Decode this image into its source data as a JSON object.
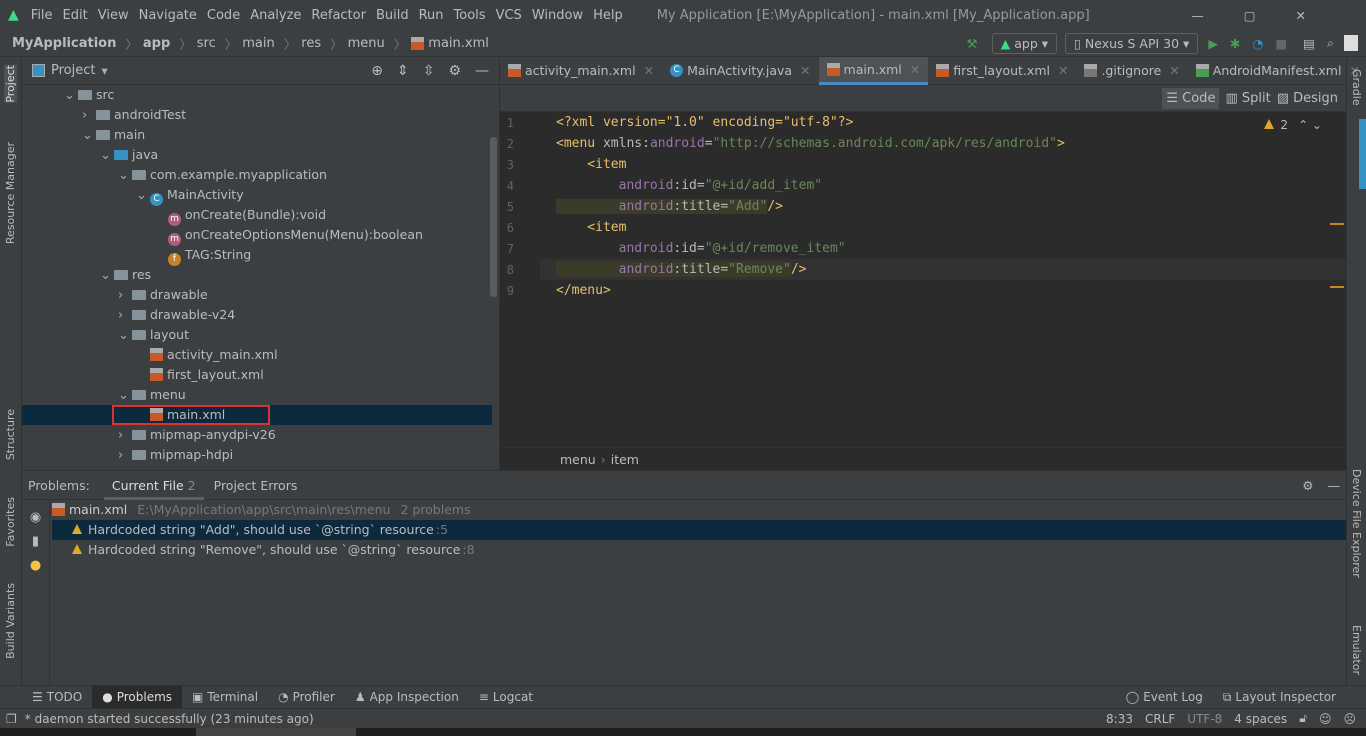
{
  "menu": {
    "items": [
      "File",
      "Edit",
      "View",
      "Navigate",
      "Code",
      "Analyze",
      "Refactor",
      "Build",
      "Run",
      "Tools",
      "VCS",
      "Window",
      "Help"
    ],
    "title": "My Application [E:\\MyApplication] - main.xml [My_Application.app]"
  },
  "nav": {
    "crumbs": [
      "MyApplication",
      "app",
      "src",
      "main",
      "res",
      "menu",
      "main.xml"
    ],
    "run_config": "app",
    "device": "Nexus S API 30"
  },
  "left_strip": [
    "Project",
    "Resource Manager",
    "Structure",
    "Favorites",
    "Build Variants"
  ],
  "right_strip": [
    "Gradle",
    "Device File Explorer",
    "Emulator"
  ],
  "project": {
    "title": "Project",
    "tree": [
      {
        "label": "src",
        "depth": 0,
        "kind": "folder",
        "open": true
      },
      {
        "label": "androidTest",
        "depth": 1,
        "kind": "folder",
        "open": false
      },
      {
        "label": "main",
        "depth": 1,
        "kind": "folder",
        "open": true
      },
      {
        "label": "java",
        "depth": 2,
        "kind": "folder",
        "open": true
      },
      {
        "label": "com.example.myapplication",
        "depth": 3,
        "kind": "package",
        "open": true
      },
      {
        "label": "MainActivity",
        "depth": 4,
        "kind": "class",
        "open": true
      },
      {
        "label": "onCreate(Bundle):void",
        "depth": 5,
        "kind": "method"
      },
      {
        "label": "onCreateOptionsMenu(Menu):boolean",
        "depth": 5,
        "kind": "method"
      },
      {
        "label": "TAG:String",
        "depth": 5,
        "kind": "field"
      },
      {
        "label": "res",
        "depth": 2,
        "kind": "folder",
        "open": true
      },
      {
        "label": "drawable",
        "depth": 3,
        "kind": "folder",
        "open": false
      },
      {
        "label": "drawable-v24",
        "depth": 3,
        "kind": "folder",
        "open": false
      },
      {
        "label": "layout",
        "depth": 3,
        "kind": "folder",
        "open": true
      },
      {
        "label": "activity_main.xml",
        "depth": 4,
        "kind": "xml"
      },
      {
        "label": "first_layout.xml",
        "depth": 4,
        "kind": "xml"
      },
      {
        "label": "menu",
        "depth": 3,
        "kind": "folder",
        "open": true
      },
      {
        "label": "main.xml",
        "depth": 4,
        "kind": "xml",
        "selected": true
      },
      {
        "label": "mipmap-anydpi-v26",
        "depth": 3,
        "kind": "folder",
        "open": false
      },
      {
        "label": "mipmap-hdpi",
        "depth": 3,
        "kind": "folder",
        "open": false
      }
    ]
  },
  "tabs": [
    {
      "label": "activity_main.xml"
    },
    {
      "label": "MainActivity.java"
    },
    {
      "label": "main.xml",
      "active": true
    },
    {
      "label": "first_layout.xml"
    },
    {
      "label": ".gitignore"
    },
    {
      "label": "AndroidManifest.xml"
    }
  ],
  "view_modes": [
    "Code",
    "Split",
    "Design"
  ],
  "warnings_count": "2",
  "code": [
    [
      [
        "tg",
        "<?xml version=\"1.0\" encoding=\"utf-8\"?>"
      ]
    ],
    [
      [
        "tg",
        "<menu "
      ],
      [
        "at",
        "xmlns:"
      ],
      [
        "ns",
        "android"
      ],
      [
        "at",
        "="
      ],
      [
        "vl",
        "\"http://schemas.android.com/apk/res/android\""
      ],
      [
        "tg",
        ">"
      ]
    ],
    [
      [
        "tg",
        "    <item"
      ]
    ],
    [
      [
        "ns",
        "        android"
      ],
      [
        "at",
        ":id="
      ],
      [
        "vl",
        "\"@+id/add_item\""
      ]
    ],
    [
      [
        "ns",
        "        android"
      ],
      [
        "at",
        ":title="
      ],
      [
        "vl",
        "\"Add\""
      ],
      [
        "tg",
        "/>"
      ]
    ],
    [
      [
        "tg",
        "    <item"
      ]
    ],
    [
      [
        "ns",
        "        android"
      ],
      [
        "at",
        ":id="
      ],
      [
        "vl",
        "\"@+id/remove_item\""
      ]
    ],
    [
      [
        "ns",
        "        android"
      ],
      [
        "at",
        ":title="
      ],
      [
        "vl",
        "\"Remove\""
      ],
      [
        "tg",
        "/>"
      ]
    ],
    [
      [
        "tg",
        "</menu>"
      ]
    ]
  ],
  "breadcrumb": [
    "menu",
    "item"
  ],
  "problems": {
    "label": "Problems:",
    "tabs": [
      "Current File",
      "Project Errors"
    ],
    "current_count": "2",
    "file": "main.xml",
    "path": "E:\\MyApplication\\app\\src\\main\\res\\menu",
    "summary": "2 problems",
    "items": [
      {
        "text": "Hardcoded string \"Add\", should use `@string` resource",
        "line": ":5"
      },
      {
        "text": "Hardcoded string \"Remove\", should use `@string` resource",
        "line": ":8"
      }
    ]
  },
  "toolwindows": [
    "TODO",
    "Problems",
    "Terminal",
    "Profiler",
    "App Inspection",
    "Logcat"
  ],
  "toolwindows_right": [
    "Event Log",
    "Layout Inspector"
  ],
  "status": {
    "message": "* daemon started successfully (23 minutes ago)",
    "position": "8:33",
    "line_sep": "CRLF",
    "encoding": "UTF-8",
    "indent": "4 spaces"
  },
  "colors": {
    "accent": "#4a88c7",
    "selection": "#0d293e",
    "warning": "#e0a82a",
    "run": "#499c54"
  }
}
